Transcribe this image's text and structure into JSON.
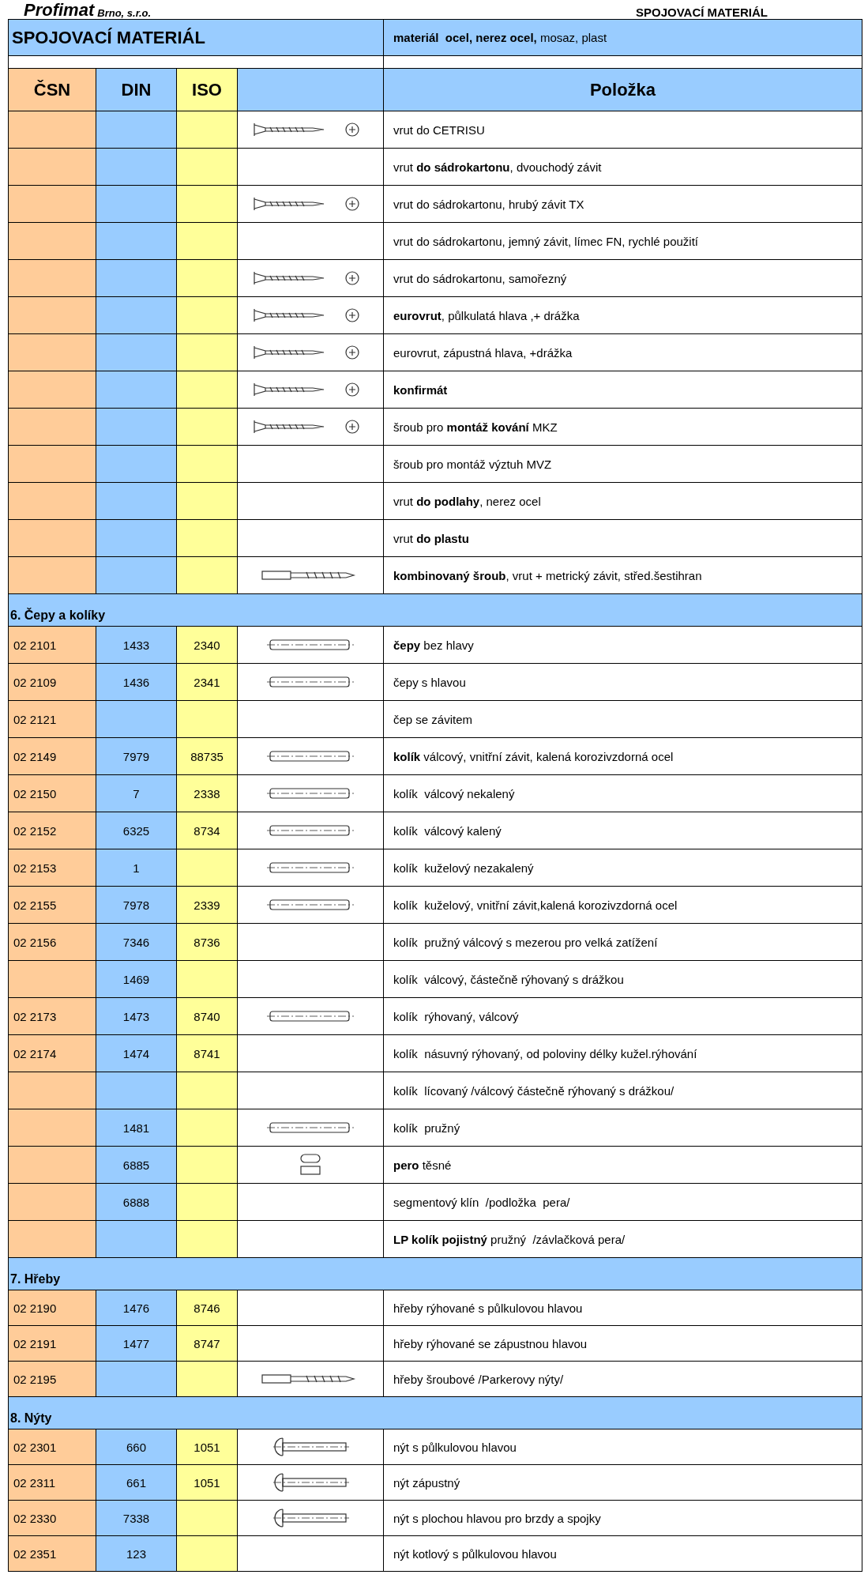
{
  "header": {
    "logo": "Profimat",
    "company": "Brno, s.r.o.",
    "title": "SPOJOVACÍ MATERIÁL"
  },
  "table": {
    "title": "SPOJOVACÍ MATERIÁL",
    "material": "**materiál  ocel, nerez ocel,** mosaz, plast",
    "columns": [
      "ČSN",
      "DIN",
      "ISO",
      "Položka"
    ],
    "sections": [
      {
        "rows": [
          {
            "item": "vrut do CETRISU",
            "kind": "screw"
          },
          {
            "item": "vrut **do sádrokartonu**, dvouchodý závit"
          },
          {
            "item": "vrut do sádrokartonu, hrubý závit TX",
            "kind": "screw"
          },
          {
            "item": "vrut do sádrokartonu, jemný závit, límec FN, rychlé použití"
          },
          {
            "item": "vrut do sádrokartonu, samořezný",
            "kind": "screw"
          },
          {
            "item": "**eurovrut**, půlkulatá hlava ,+ drážka",
            "kind": "screw"
          },
          {
            "item": "eurovrut, zápustná hlava, +drážka",
            "kind": "screw"
          },
          {
            "item": "**konfirmát**",
            "kind": "screw"
          },
          {
            "item": "šroub pro **montáž kování** MKZ",
            "kind": "screw"
          },
          {
            "item": "šroub pro montáž výztuh MVZ"
          },
          {
            "item": "vrut **do podlahy**, nerez ocel"
          },
          {
            "item": "vrut **do plastu**"
          },
          {
            "item": "**kombinovaný šroub**, vrut + metrický závit, střed.šestihran",
            "kind": "bolt"
          }
        ]
      },
      {
        "title": "6. Čepy a kolíky",
        "rows": [
          {
            "csn": "02 2101",
            "din": "1433",
            "iso": "2340",
            "item": "**čepy** bez hlavy",
            "kind": "pin"
          },
          {
            "csn": "02 2109",
            "din": "1436",
            "iso": "2341",
            "item": "čepy s hlavou",
            "kind": "pin"
          },
          {
            "csn": "02 2121",
            "item": "čep se závitem"
          },
          {
            "csn": "02 2149",
            "din": "7979",
            "iso": "88735",
            "item": "**kolík** válcový, vnitřní závit, kalená korozivzdorná ocel",
            "kind": "pin"
          },
          {
            "csn": "02 2150",
            "din": "7",
            "iso": "2338",
            "item": "kolík  válcový nekalený",
            "kind": "pin"
          },
          {
            "csn": "02 2152",
            "din": "6325",
            "iso": "8734",
            "item": "kolík  válcový kalený",
            "kind": "pin"
          },
          {
            "csn": "02 2153",
            "din": "1",
            "item": "kolík  kuželový nezakalený",
            "kind": "pin"
          },
          {
            "csn": "02 2155",
            "din": "7978",
            "iso": "2339",
            "item": "kolík  kuželový, vnitřní závit,kalená korozivzdorná ocel",
            "kind": "pin"
          },
          {
            "csn": "02 2156",
            "din": "7346",
            "iso": "8736",
            "item": "kolík  pružný válcový s mezerou pro velká zatížení"
          },
          {
            "din": "1469",
            "item": "kolík  válcový, částečně rýhovaný s drážkou"
          },
          {
            "csn": "02 2173",
            "din": "1473",
            "iso": "8740",
            "item": "kolík  rýhovaný, válcový",
            "kind": "pin"
          },
          {
            "csn": "02 2174",
            "din": "1474",
            "iso": "8741",
            "item": "kolík  násuvný rýhovaný, od poloviny délky kužel.rýhování"
          },
          {
            "item": "kolík  lícovaný /válcový částečně rýhovaný s drážkou/"
          },
          {
            "din": "1481",
            "item": "kolík  pružný",
            "kind": "pin"
          },
          {
            "din": "6885",
            "item": "**pero** těsné",
            "kind": "key"
          },
          {
            "din": "6888",
            "item": "segmentový klín  /podložka  pera/"
          },
          {
            "item": "**LP kolík pojistný** pružný  /závlačková pera/"
          }
        ]
      },
      {
        "title": "7.  Hřeby",
        "rows": [
          {
            "csn": "02 2190",
            "din": "1476",
            "iso": "8746",
            "item": "hřeby rýhované s půlkulovou hlavou"
          },
          {
            "csn": "02 2191",
            "din": "1477",
            "iso": "8747",
            "item": "hřeby rýhované se zápustnou hlavou"
          },
          {
            "csn": "02 2195",
            "item": "hřeby šroubové /Parkerovy nýty/",
            "kind": "bolt"
          }
        ]
      },
      {
        "title": "8.  Nýty",
        "rows": [
          {
            "csn": "02 2301",
            "din": "660",
            "iso": "1051",
            "item": "nýt s půlkulovou hlavou",
            "kind": "rivet"
          },
          {
            "csn": "02 2311",
            "din": "661",
            "iso": "1051",
            "item": "nýt zápustný",
            "kind": "rivet"
          },
          {
            "csn": "02 2330",
            "din": "7338",
            "item": "nýt s plochou hlavou pro brzdy a spojky",
            "kind": "rivet"
          },
          {
            "csn": "02 2351",
            "din": "123",
            "item": "nýt kotlový s půlkulovou hlavou"
          }
        ]
      }
    ]
  }
}
